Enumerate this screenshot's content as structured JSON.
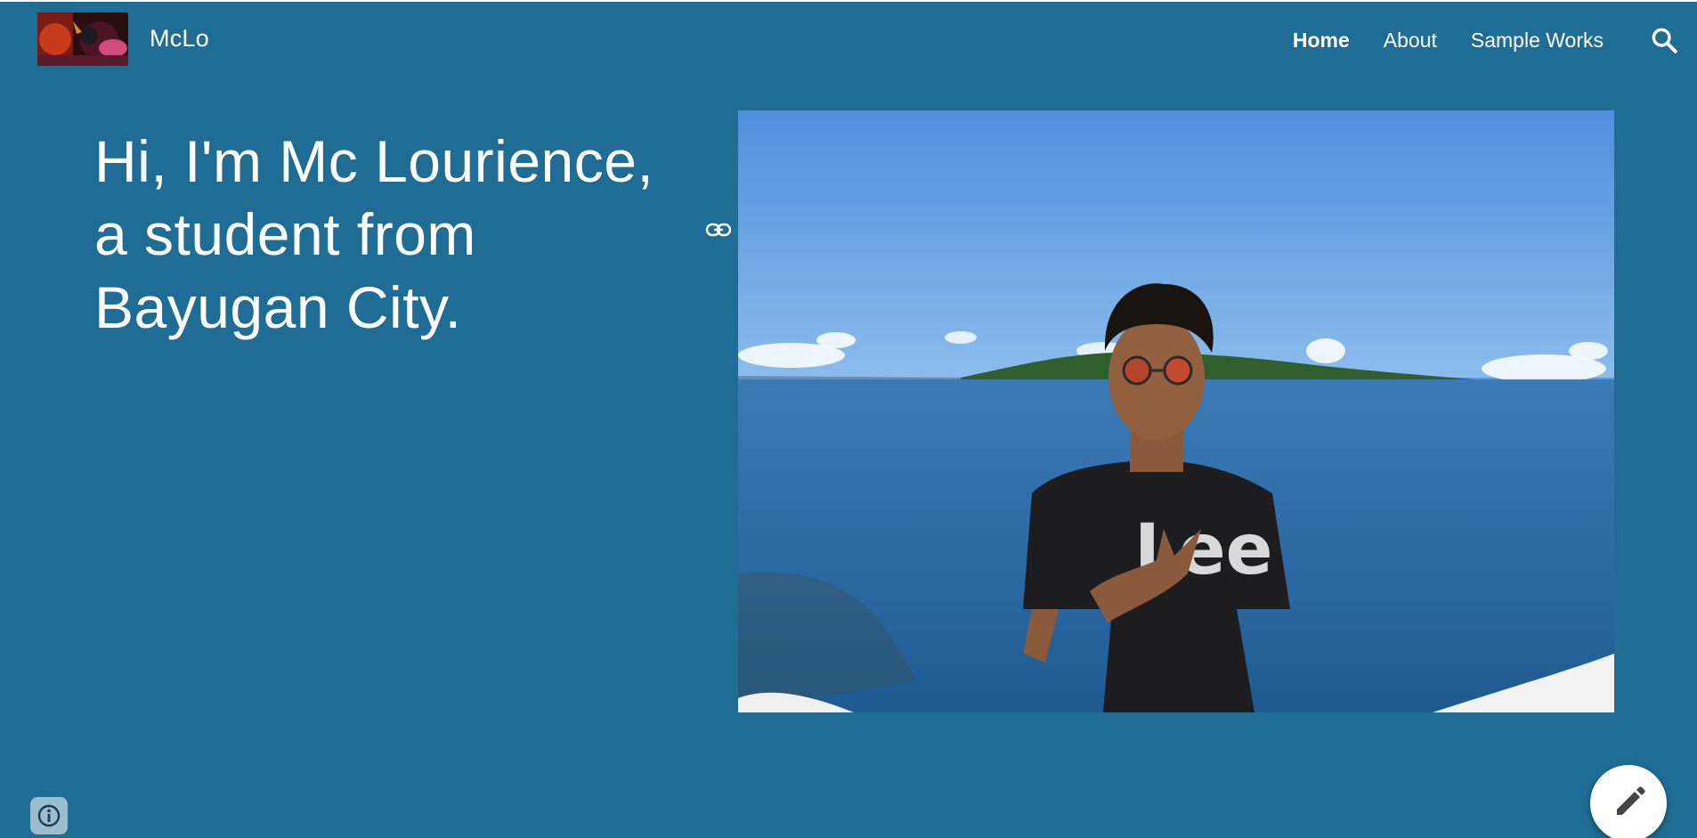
{
  "header": {
    "logo_icon": "site-logo-image",
    "site_title": "McLo",
    "nav": [
      {
        "label": "Home",
        "active": true
      },
      {
        "label": "About",
        "active": false
      },
      {
        "label": "Sample Works",
        "active": false
      }
    ],
    "search_icon": "search-icon"
  },
  "hero": {
    "heading_lines": [
      "Hi, I'm Mc Lourience,",
      "a student from",
      "Bayugan City."
    ],
    "link_icon": "link-icon",
    "photo": {
      "description_icon": "person-by-the-sea-photo",
      "shirt_text": "Lee"
    }
  },
  "footer": {
    "info_icon": "info-icon",
    "edit_icon": "pencil-icon"
  },
  "colors": {
    "background": "#1f6d95",
    "text": "#ffffff",
    "sky": "#5a9be0",
    "sea": "#2f6aa3"
  }
}
